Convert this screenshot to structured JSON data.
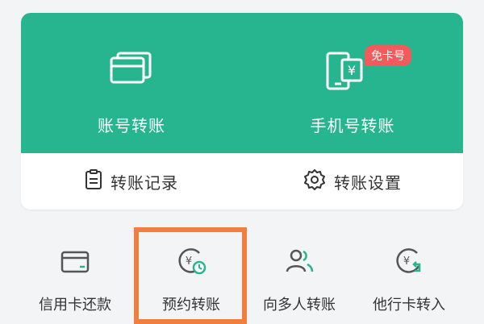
{
  "colors": {
    "accent": "#26b58e",
    "badge": "#f25b5b",
    "highlight": "#f07e3f",
    "text": "#333333"
  },
  "transfer_card": {
    "account_transfer": {
      "label": "账号转账",
      "icon": "bank-card-icon"
    },
    "phone_transfer": {
      "label": "手机号转账",
      "icon": "phone-yuan-icon",
      "badge": "免卡号"
    },
    "records": {
      "label": "转账记录",
      "icon": "document-icon"
    },
    "settings": {
      "label": "转账设置",
      "icon": "gear-icon"
    }
  },
  "quick_actions": [
    {
      "label": "信用卡还款",
      "icon": "credit-card-icon"
    },
    {
      "label": "预约转账",
      "icon": "scheduled-transfer-icon",
      "highlighted": true
    },
    {
      "label": "向多人转账",
      "icon": "multi-user-icon"
    },
    {
      "label": "他行卡转入",
      "icon": "yuan-return-icon"
    }
  ]
}
